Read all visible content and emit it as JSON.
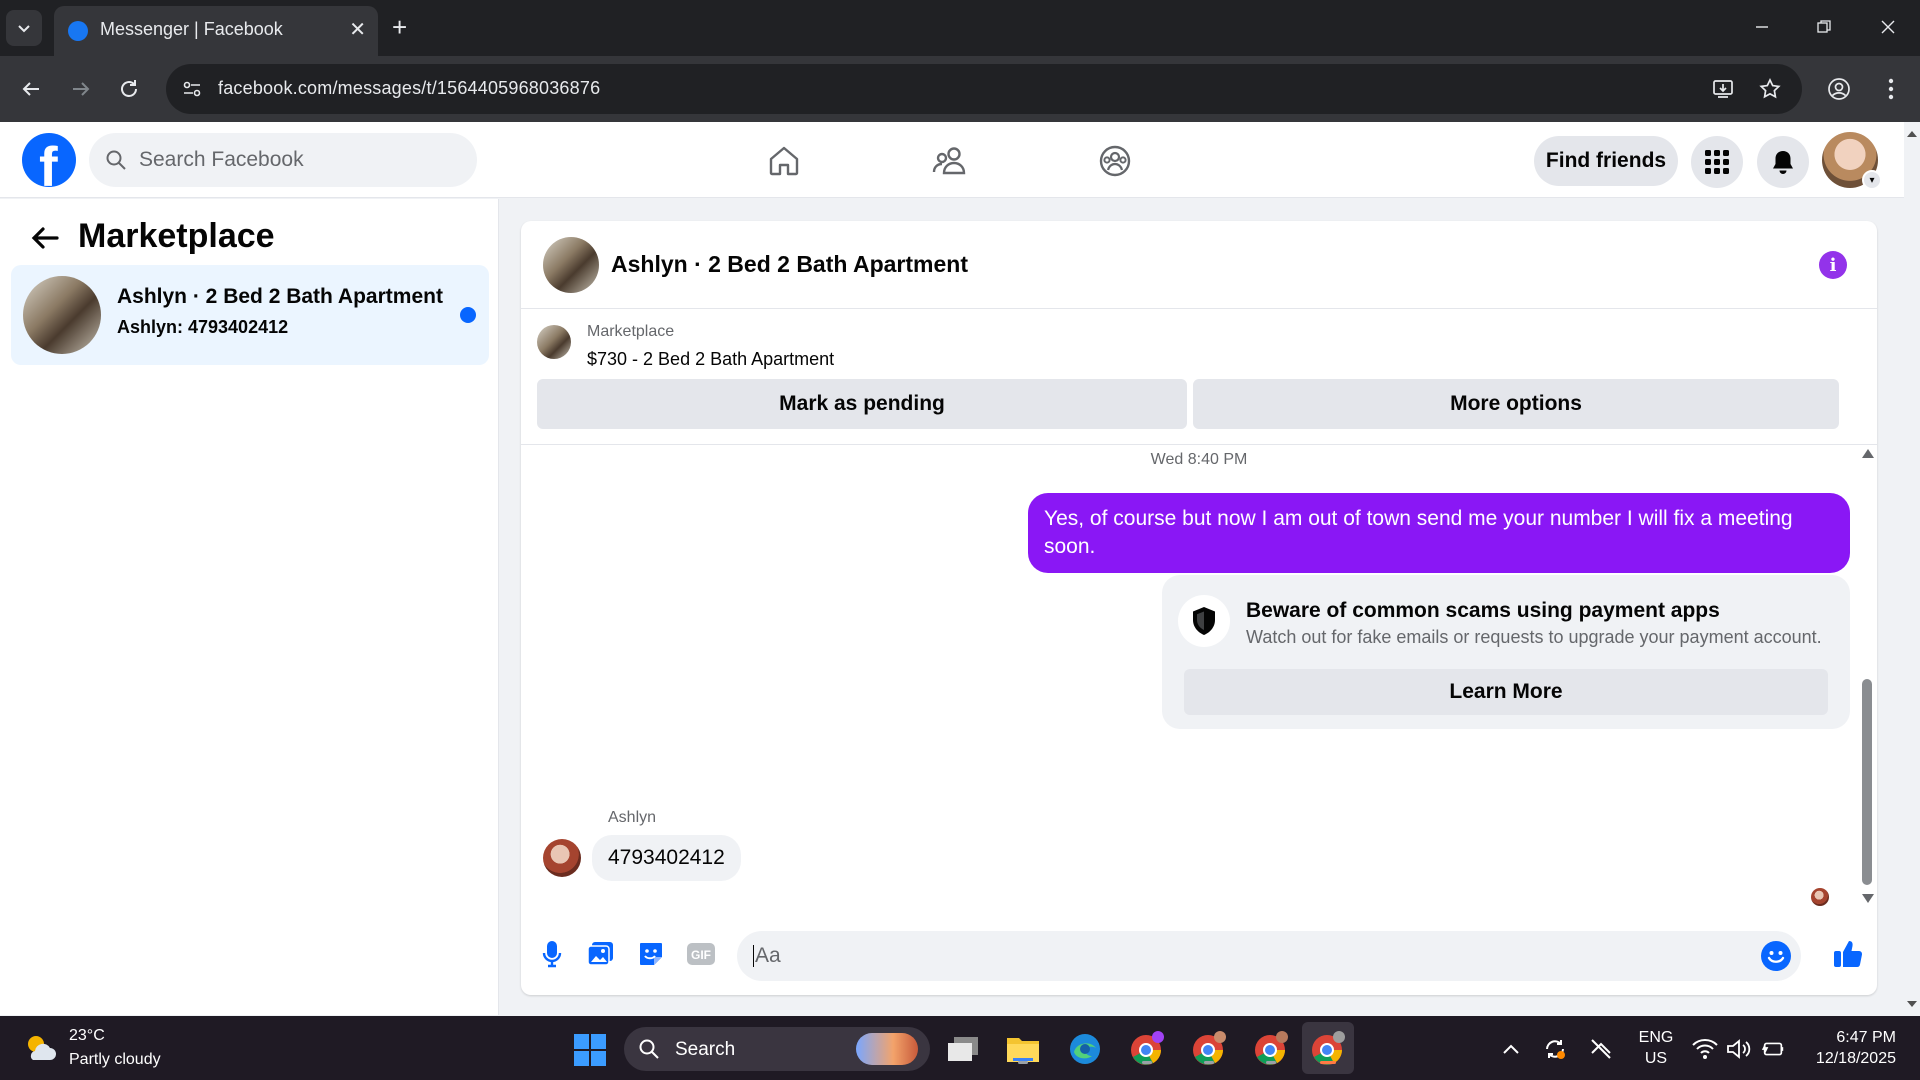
{
  "browser": {
    "tab_title": "Messenger | Facebook",
    "url": "facebook.com/messages/t/1564405968036876"
  },
  "fb_nav": {
    "search_placeholder": "Search Facebook",
    "find_friends_label": "Find friends"
  },
  "left_panel": {
    "title": "Marketplace",
    "conversations": [
      {
        "name": "Ashlyn · 2 Bed 2 Bath Apartment",
        "preview": "Ashlyn: 4793402412",
        "unread": true
      }
    ]
  },
  "chat": {
    "header_title": "Ashlyn · 2 Bed 2 Bath Apartment",
    "listing": {
      "category": "Marketplace",
      "title": "$730 - 2 Bed 2 Bath Apartment",
      "mark_pending_label": "Mark as pending",
      "more_options_label": "More options"
    },
    "messages": {
      "timestamp": "Wed 8:40 PM",
      "outgoing_text": "Yes, of course but now I am out of town send me your number I will fix a meeting soon.",
      "scam_notice": {
        "title": "Beware of common scams using payment apps",
        "body": "Watch out for fake emails or requests to upgrade your payment account.",
        "button_label": "Learn More"
      },
      "incoming_sender": "Ashlyn",
      "incoming_text": "4793402412"
    },
    "composer": {
      "placeholder": "Aa",
      "gif_label": "GIF"
    }
  },
  "taskbar": {
    "weather_temp": "23°C",
    "weather_desc": "Partly cloudy",
    "search_label": "Search",
    "language_line1": "ENG",
    "language_line2": "US",
    "time": "6:47 PM",
    "date": "12/18/2025"
  },
  "colors": {
    "fb_blue": "#0866ff",
    "messenger_purple": "#8a17f5",
    "info_purple": "#9333ea",
    "unread_highlight": "#ebf5ff"
  }
}
